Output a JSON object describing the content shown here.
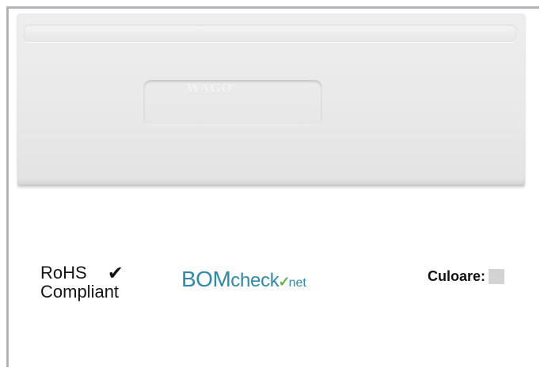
{
  "product_image": {
    "embossed_mark": "WAGO",
    "color_plate": "#e9e9e9"
  },
  "rohs": {
    "line1": "RoHS",
    "check": "✔",
    "line2": "Compliant"
  },
  "bomcheck": {
    "bom": "BOM",
    "check": "check",
    "tick": "✓",
    "net": "net",
    "brand_color": "#2f8aa7",
    "tick_color": "#66b244"
  },
  "color_info": {
    "label": "Culoare:",
    "swatch_color": "#d3d3d3"
  }
}
